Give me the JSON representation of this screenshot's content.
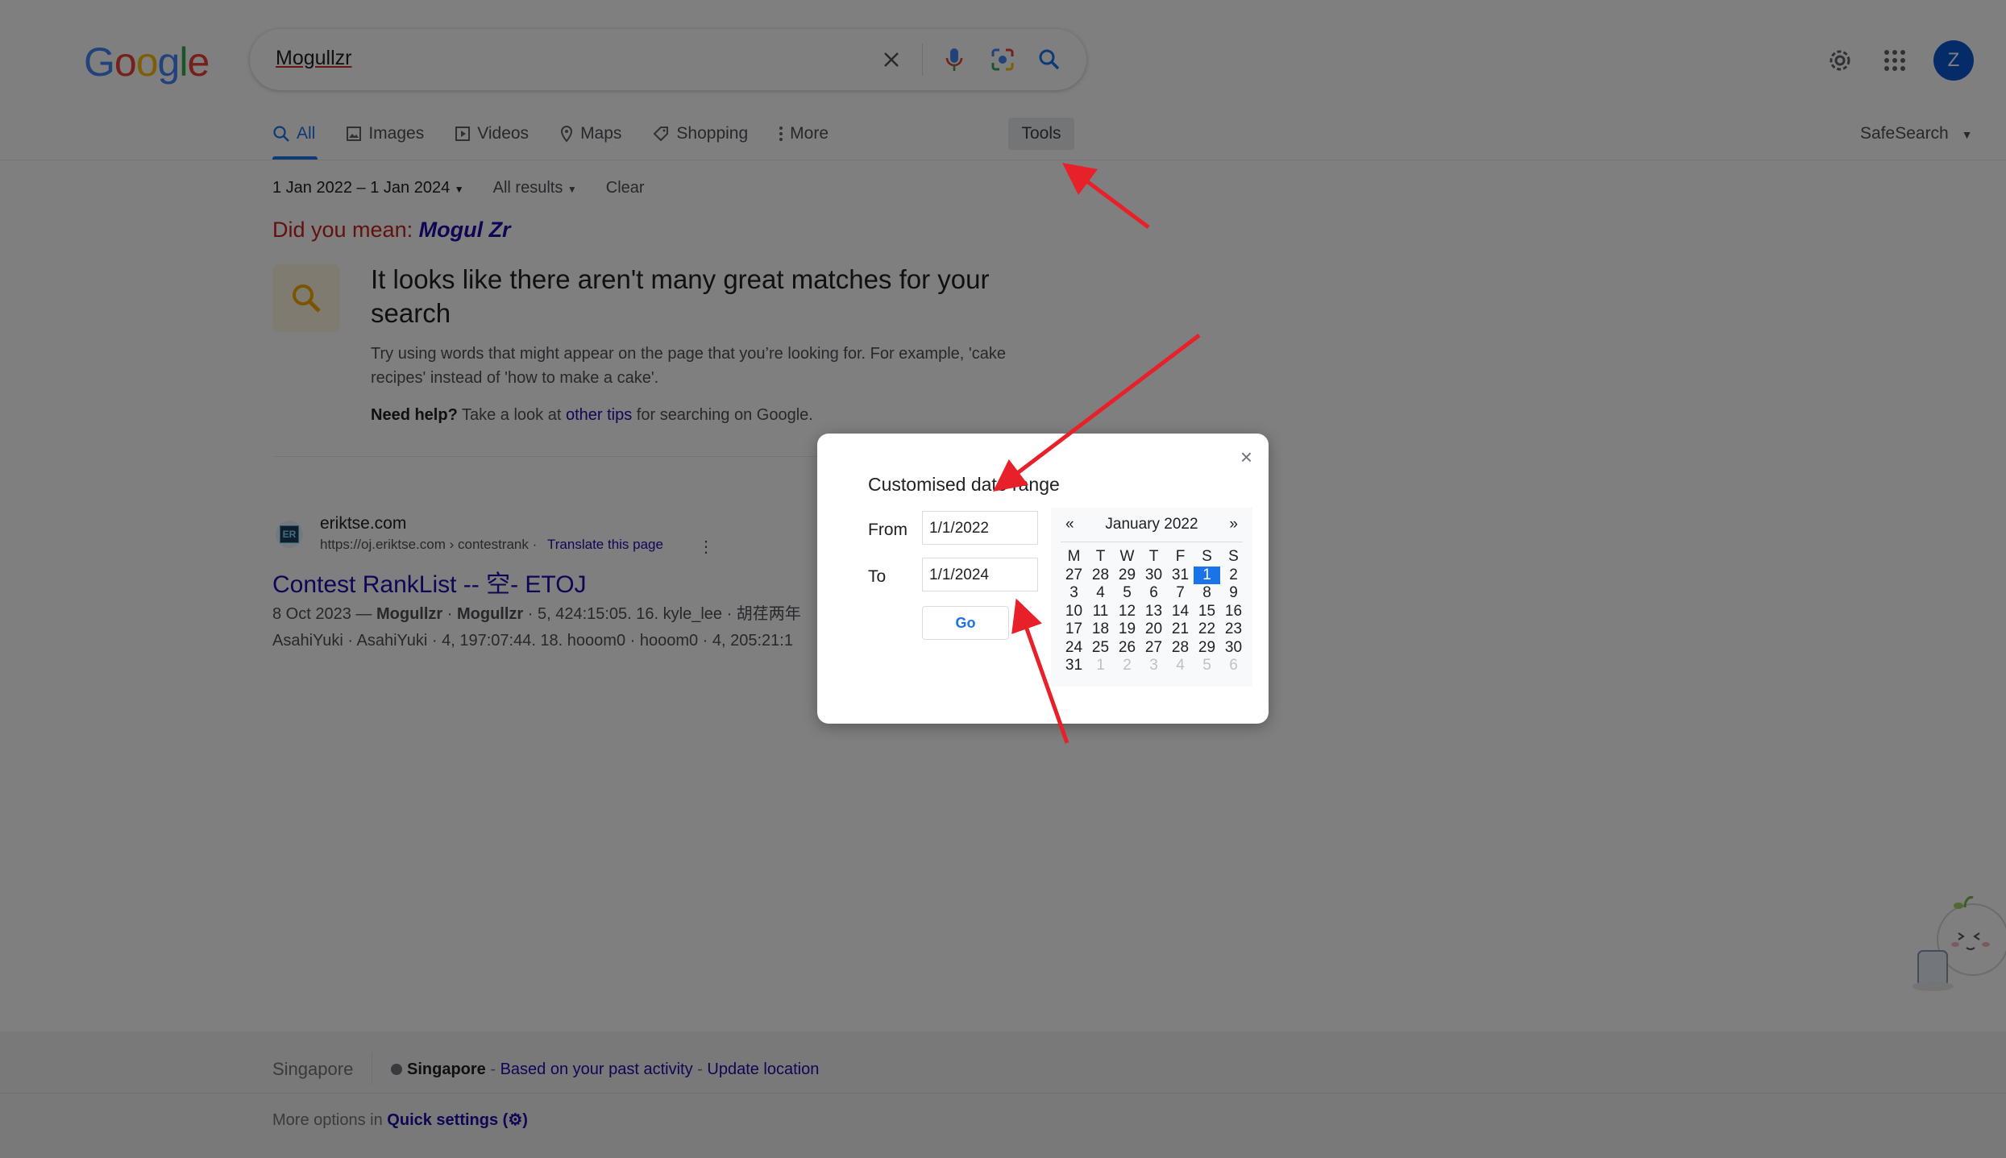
{
  "header": {
    "logo_letters": [
      "G",
      "o",
      "o",
      "g",
      "l",
      "e"
    ],
    "logo_colors": [
      "#4285f4",
      "#ea4335",
      "#fbbc05",
      "#4285f4",
      "#34a853",
      "#ea4335"
    ],
    "search_value": "Mogullzr",
    "avatar_letter": "Z"
  },
  "tabs": [
    {
      "label": "All",
      "icon": "search-icon"
    },
    {
      "label": "Images",
      "icon": "image-icon"
    },
    {
      "label": "Videos",
      "icon": "video-icon"
    },
    {
      "label": "Maps",
      "icon": "map-pin-icon"
    },
    {
      "label": "Shopping",
      "icon": "tag-icon"
    },
    {
      "label": "More",
      "icon": "more-vert-icon"
    }
  ],
  "tools_label": "Tools",
  "safesearch_label": "SafeSearch",
  "filters": {
    "date_range": "1 Jan 2022 – 1 Jan 2024",
    "results": "All results",
    "clear": "Clear"
  },
  "did_you_mean": {
    "prefix": "Did you mean: ",
    "suggestion": "Mogul Zr"
  },
  "tip": {
    "title": "It looks like there aren't many great matches for your search",
    "body": "Try using words that might appear on the page that you’re looking for. For example, 'cake recipes' instead of 'how to make a cake'.",
    "help_bold": "Need help?",
    "help_pre": " Take a look at ",
    "help_link": "other tips",
    "help_post": " for searching on Google."
  },
  "result": {
    "favicon_text": "ER",
    "site_name": "eriktse.com",
    "url": "https://oj.eriktse.com › contestrank",
    "translate": "Translate this page",
    "title": "Contest RankList -- 空- ETOJ",
    "snippet_date": "8 Oct 2023 — ",
    "snippet_b1": "Mogullzr",
    "snippet_mid": " · ",
    "snippet_b2": "Mogullzr",
    "snippet_rest": " · 5, 424:15:05. 16. kyle_lee · 胡荏两年",
    "snippet_line2": "AsahiYuki · AsahiYuki · 4, 197:07:44. 18. hooom0 · hooom0 · 4, 205:21:1"
  },
  "footer": {
    "country": "Singapore",
    "loc_bold": "Singapore",
    "loc_sep1": " - ",
    "loc_link1": "Based on your past activity",
    "loc_sep2": " - ",
    "loc_link2": "Update location",
    "more_prefix": "More options in ",
    "more_link": "Quick settings (⚙)"
  },
  "dialog": {
    "title": "Customised date range",
    "from_label": "From",
    "from_value": "1/1/2022",
    "to_label": "To",
    "to_value": "1/1/2024",
    "go_label": "Go",
    "close_glyph": "×"
  },
  "calendar": {
    "prev": "«",
    "month": "January 2022",
    "next": "»",
    "weekdays": [
      "M",
      "T",
      "W",
      "T",
      "F",
      "S",
      "S"
    ],
    "days": [
      {
        "t": "27",
        "o": false
      },
      {
        "t": "28",
        "o": false
      },
      {
        "t": "29",
        "o": false
      },
      {
        "t": "30",
        "o": false
      },
      {
        "t": "31",
        "o": false
      },
      {
        "t": "1",
        "o": false,
        "sel": true
      },
      {
        "t": "2",
        "o": false
      },
      {
        "t": "3"
      },
      {
        "t": "4"
      },
      {
        "t": "5"
      },
      {
        "t": "6"
      },
      {
        "t": "7"
      },
      {
        "t": "8"
      },
      {
        "t": "9"
      },
      {
        "t": "10"
      },
      {
        "t": "11"
      },
      {
        "t": "12"
      },
      {
        "t": "13"
      },
      {
        "t": "14"
      },
      {
        "t": "15"
      },
      {
        "t": "16"
      },
      {
        "t": "17"
      },
      {
        "t": "18"
      },
      {
        "t": "19"
      },
      {
        "t": "20"
      },
      {
        "t": "21"
      },
      {
        "t": "22"
      },
      {
        "t": "23"
      },
      {
        "t": "24"
      },
      {
        "t": "25"
      },
      {
        "t": "26"
      },
      {
        "t": "27"
      },
      {
        "t": "28"
      },
      {
        "t": "29"
      },
      {
        "t": "30"
      },
      {
        "t": "31"
      },
      {
        "t": "1",
        "o": true
      },
      {
        "t": "2",
        "o": true
      },
      {
        "t": "3",
        "o": true
      },
      {
        "t": "4",
        "o": true
      },
      {
        "t": "5",
        "o": true
      },
      {
        "t": "6",
        "o": true
      }
    ]
  },
  "colors": {
    "accent": "#1a73e8",
    "link": "#1a0dab",
    "annotation_arrow": "#e8202a"
  }
}
